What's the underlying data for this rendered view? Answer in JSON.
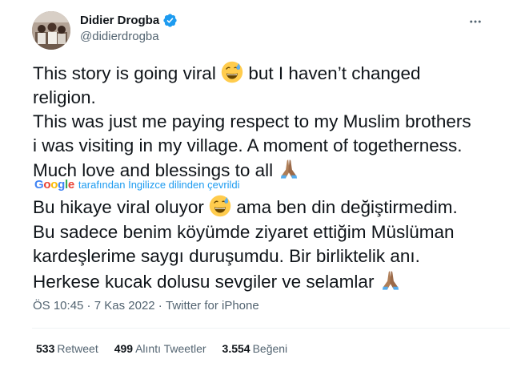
{
  "author": {
    "name": "Didier Drogba",
    "handle": "@didierdrogba",
    "verified_color": "#1d9bf0"
  },
  "tweet": {
    "lines": [
      "This story is going viral",
      "but I haven’t changed",
      "religion.",
      "This was just me paying respect to my Muslim brothers",
      "i was visiting in my village. A moment of togetherness.",
      "Much love and blessings to all"
    ]
  },
  "translation": {
    "provider": "Google",
    "notice": "tarafından İngilizce dilinden çevrildi",
    "link_color": "#1d9bf0",
    "lines": [
      "Bu hikaye viral oluyor",
      "ama ben din değiştirmedim.",
      "Bu sadece benim köyümde ziyaret ettiğim Müslüman",
      "kardeşlerime saygı duruşumdu. Bir birliktelik anı.",
      "Herkese kucak dolusu sevgiler ve selamlar"
    ]
  },
  "meta": {
    "time": "ÖS 10:45",
    "separator": " · ",
    "date": "7 Kas 2022",
    "source": "Twitter for iPhone"
  },
  "stats": {
    "retweets": {
      "count": "533",
      "label": "Retweet"
    },
    "quotes": {
      "count": "499",
      "label": "Alıntı Tweetler"
    },
    "likes": {
      "count": "3.554",
      "label": "Beğeni"
    }
  },
  "icons": {
    "more": "more-horizontal-icon",
    "verified": "verified-badge-icon",
    "sweat_smile": "grinning-face-with-sweat-emoji",
    "pray": "folded-hands-emoji"
  },
  "colors": {
    "text": "#0f1419",
    "secondary": "#536471",
    "divider": "#eff3f4"
  }
}
